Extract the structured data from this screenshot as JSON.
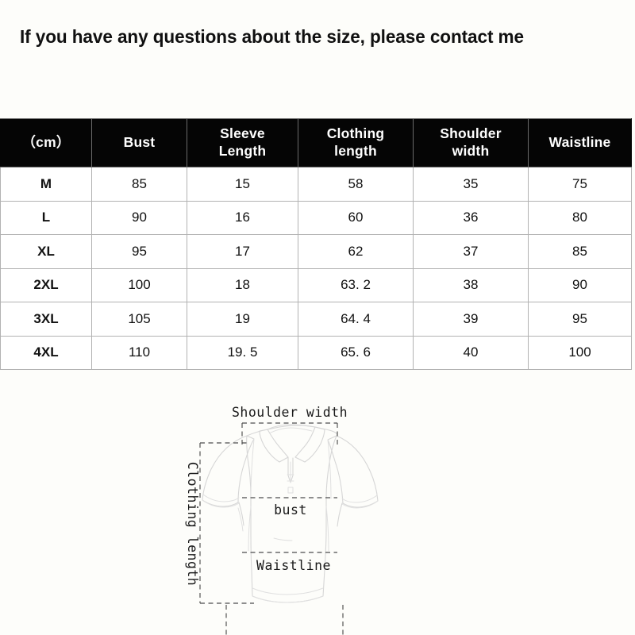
{
  "page": {
    "title": "If you have any questions about the size, please contact me",
    "background_color": "#fdfdfa"
  },
  "size_table": {
    "header_background": "#050505",
    "header_text_color": "#ffffff",
    "border_color": "#b2b2b2",
    "columns": [
      "（cm）",
      "Bust",
      "Sleeve Length",
      "Clothing length",
      "Shoulder width",
      "Waistline"
    ],
    "column_lines": [
      [
        "（cm）"
      ],
      [
        "Bust"
      ],
      [
        "Sleeve",
        "Length"
      ],
      [
        "Clothing",
        "length"
      ],
      [
        "Shoulder",
        "width"
      ],
      [
        "Waistline"
      ]
    ],
    "rows": [
      {
        "size": "M",
        "bust": "85",
        "sleeve_length": "15",
        "clothing_length": "58",
        "shoulder_width": "35",
        "waistline": "75"
      },
      {
        "size": "L",
        "bust": "90",
        "sleeve_length": "16",
        "clothing_length": "60",
        "shoulder_width": "36",
        "waistline": "80"
      },
      {
        "size": "XL",
        "bust": "95",
        "sleeve_length": "17",
        "clothing_length": "62",
        "shoulder_width": "37",
        "waistline": "85"
      },
      {
        "size": "2XL",
        "bust": "100",
        "sleeve_length": "18",
        "clothing_length": "63. 2",
        "shoulder_width": "38",
        "waistline": "90"
      },
      {
        "size": "3XL",
        "bust": "105",
        "sleeve_length": "19",
        "clothing_length": "64. 4",
        "shoulder_width": "39",
        "waistline": "95"
      },
      {
        "size": "4XL",
        "bust": "110",
        "sleeve_length": "19. 5",
        "clothing_length": "65. 6",
        "shoulder_width": "40",
        "waistline": "100"
      }
    ]
  },
  "diagram": {
    "garment": "polo-shirt",
    "outline_color": "#d6d6d6",
    "guide_color": "#4d4d4d",
    "labels": {
      "shoulder_width": "Shoulder width",
      "clothing_length": "Clothing length",
      "bust": "bust",
      "waistline": "Waistline"
    }
  }
}
